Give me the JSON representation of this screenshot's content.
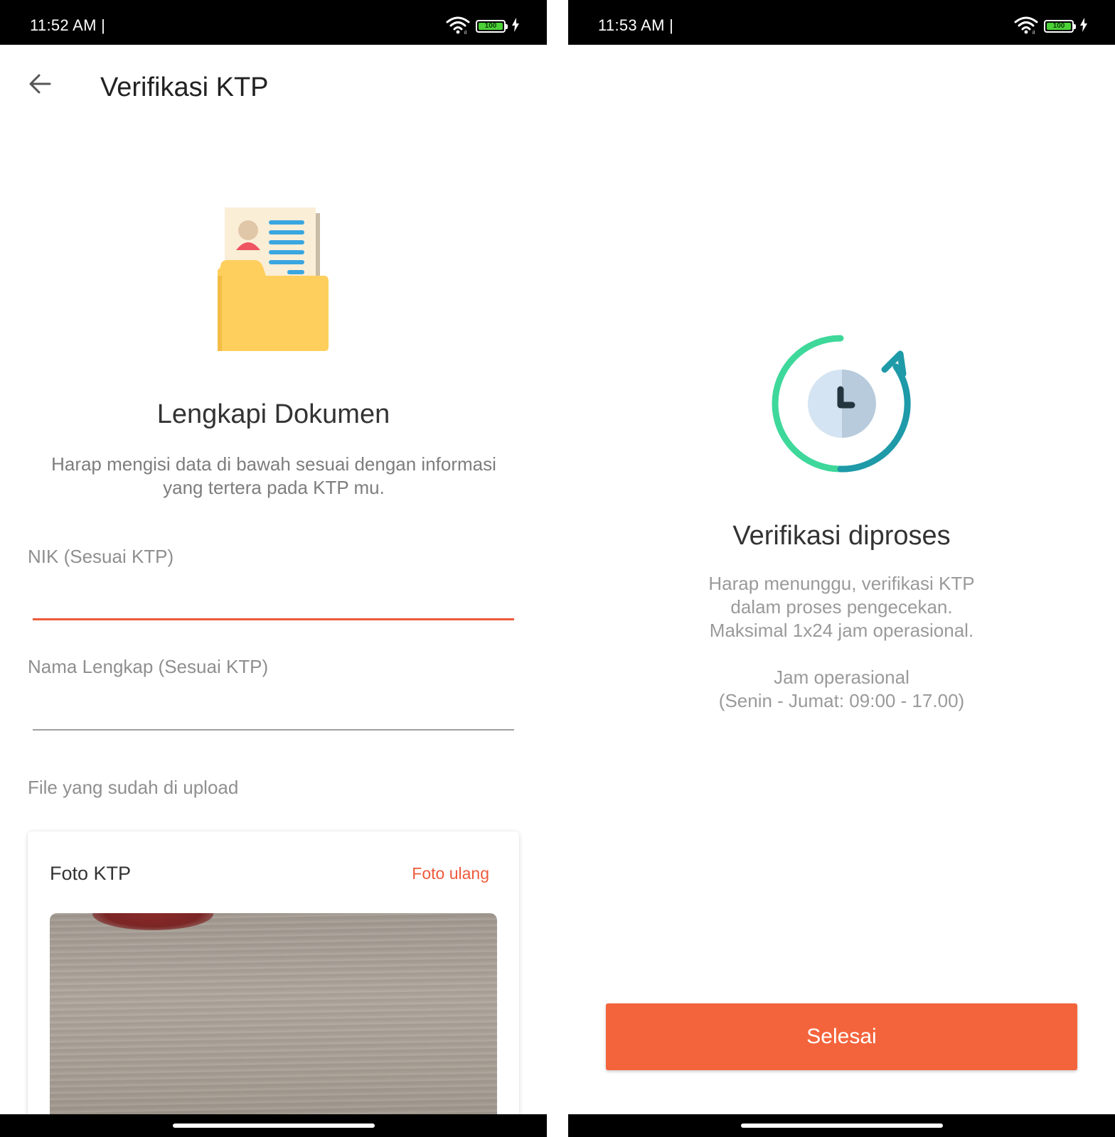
{
  "left_screen": {
    "status_bar": {
      "time": "11:52 AM |",
      "battery": "100"
    },
    "header": {
      "back_icon": "arrow-left-icon",
      "title": "Verifikasi KTP"
    },
    "illustration": "document-folder-icon",
    "section": {
      "title": "Lengkapi Dokumen",
      "description_line1": "Harap mengisi data di bawah sesuai dengan informasi",
      "description_line2": "yang tertera pada KTP mu."
    },
    "form": {
      "nik_label": "NIK (Sesuai KTP)",
      "nik_value": "",
      "nama_label": "Nama Lengkap (Sesuai KTP)",
      "nama_value": ""
    },
    "upload": {
      "label": "File yang sudah di upload",
      "card_title": "Foto KTP",
      "retake_label": "Foto ulang"
    }
  },
  "right_screen": {
    "status_bar": {
      "time": "11:53 AM |",
      "battery": "100"
    },
    "illustration": "clock-refresh-icon",
    "title": "Verifikasi diproses",
    "description": [
      "Harap menunggu, verifikasi KTP",
      "dalam proses pengecekan.",
      "Maksimal 1x24 jam operasional."
    ],
    "hours_title": "Jam operasional",
    "hours_value": "(Senin - Jumat: 09:00 - 17.00)",
    "finish_button": "Selesai"
  },
  "colors": {
    "accent": "#f4643c",
    "accent_text": "#ee5a3b",
    "folder": "#fecf5c",
    "clock_green": "#3ed89b",
    "clock_teal": "#1e9aa8"
  }
}
